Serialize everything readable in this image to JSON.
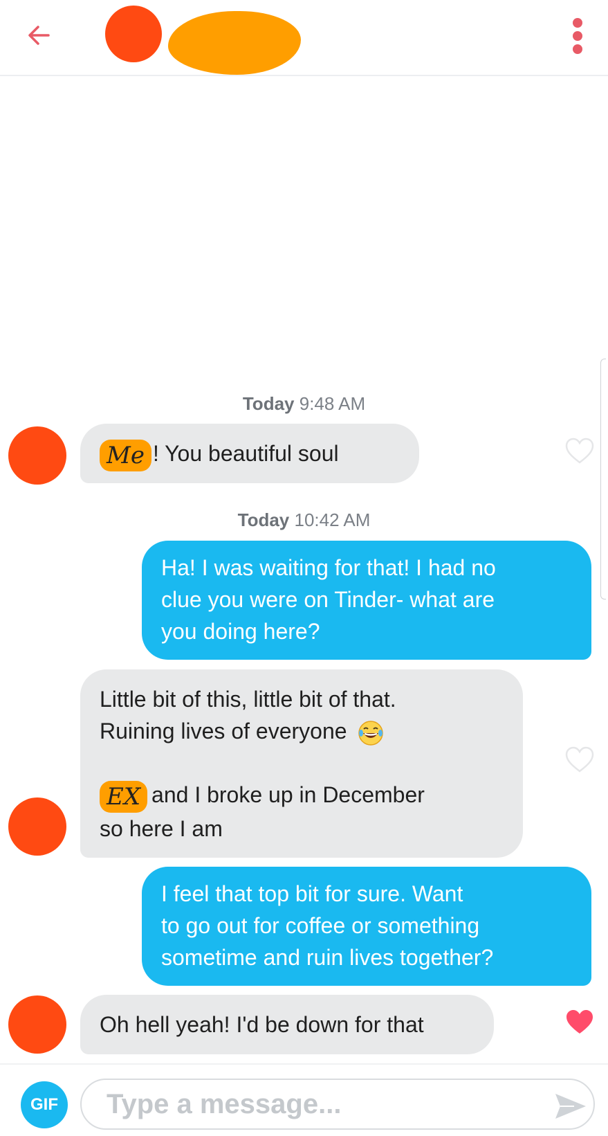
{
  "header": {
    "back_icon": "arrow-left-icon",
    "more_icon": "more-vertical-icon",
    "accent_color": "#e85a66"
  },
  "messages": [
    {
      "type": "timestamp",
      "day": "Today",
      "time": "9:48 AM"
    },
    {
      "type": "incoming",
      "redacted": "Me",
      "text": "! You beautiful soul",
      "liked": false
    },
    {
      "type": "timestamp",
      "day": "Today",
      "time": "10:42 AM"
    },
    {
      "type": "outgoing",
      "lines": [
        "Ha! I was waiting for that! I had no",
        "clue you were on Tinder- what are",
        "you doing here?"
      ]
    },
    {
      "type": "incoming",
      "lines": [
        "Little bit of this, little bit of that.",
        "Ruining lives of everyone"
      ],
      "emoji": "laughing-tears-emoji",
      "redacted": "EX",
      "lines2": [
        "and I broke up in December",
        "so here I am"
      ],
      "liked": false
    },
    {
      "type": "outgoing",
      "lines": [
        "I feel that top bit for sure. Want",
        "to go out for coffee or something",
        "sometime and ruin lives together?"
      ]
    },
    {
      "type": "incoming",
      "text": "Oh hell yeah! I'd be down for that",
      "liked": true
    }
  ],
  "composer": {
    "gif_label": "GIF",
    "placeholder": "Type a message...",
    "send_icon": "send-icon"
  },
  "colors": {
    "outgoing_bubble": "#1ab9f0",
    "incoming_bubble": "#e8e9ea",
    "like_active": "#ff4c6a",
    "redaction_avatar": "#ff4a12",
    "redaction_name": "#ff9e00"
  }
}
